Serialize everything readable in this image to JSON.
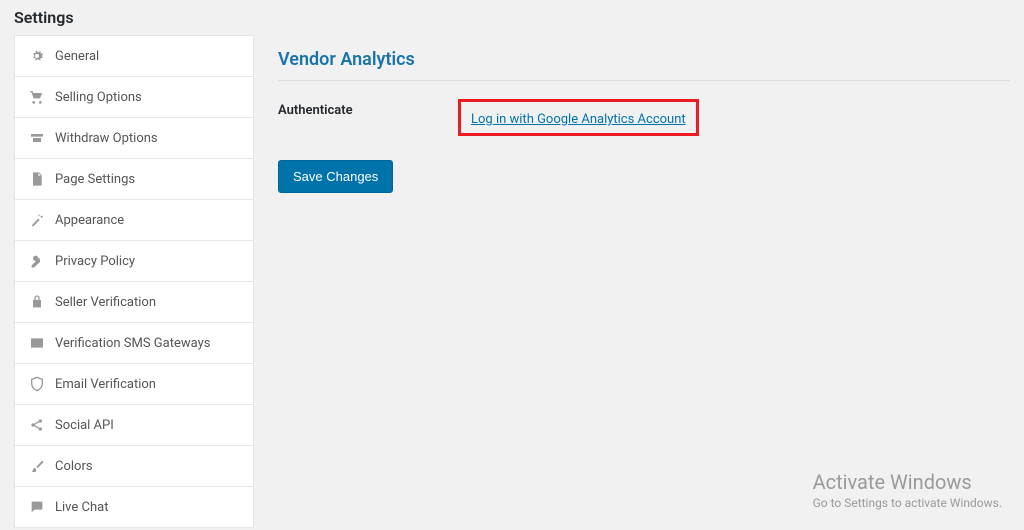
{
  "page_title": "Settings",
  "sidebar": {
    "items": [
      {
        "label": "General",
        "icon": "gear-icon",
        "color": "c-blue"
      },
      {
        "label": "Selling Options",
        "icon": "cart-icon",
        "color": "c-teal"
      },
      {
        "label": "Withdraw Options",
        "icon": "withdraw-icon",
        "color": "c-orange"
      },
      {
        "label": "Page Settings",
        "icon": "page-icon",
        "color": "c-purple"
      },
      {
        "label": "Appearance",
        "icon": "wand-icon",
        "color": "c-lblue"
      },
      {
        "label": "Privacy Policy",
        "icon": "key-icon",
        "color": "c-grey"
      },
      {
        "label": "Seller Verification",
        "icon": "lock-icon",
        "color": "c-grey"
      },
      {
        "label": "Verification SMS Gateways",
        "icon": "mail-icon",
        "color": "c-grey"
      },
      {
        "label": "Email Verification",
        "icon": "shield-icon",
        "color": "c-grey"
      },
      {
        "label": "Social API",
        "icon": "share-icon",
        "color": "c-green"
      },
      {
        "label": "Colors",
        "icon": "brush-icon",
        "color": "c-dark"
      },
      {
        "label": "Live Chat",
        "icon": "chat-icon",
        "color": "c-grey"
      }
    ]
  },
  "main": {
    "section_title": "Vendor Analytics",
    "authenticate_label": "Authenticate",
    "login_link_text": "Log in with Google Analytics Account",
    "save_button": "Save Changes"
  },
  "watermark": {
    "title": "Activate Windows",
    "subtitle": "Go to Settings to activate Windows."
  }
}
